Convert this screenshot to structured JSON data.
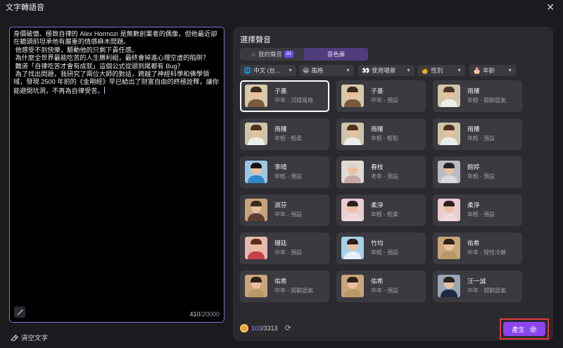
{
  "window": {
    "title": "文字轉語音"
  },
  "editor": {
    "text": "身價破億、極致自律的 Alex Hormozi 是無數創業者的偶像，但他最近卻在鏡頭前坦承他有嚴重的情感麻木問題。\n 他感受不到快樂，驅動他的只剩下責任感。\n 為什麼全世界最能吃苦的人生勝利組，最終會掉進心理空虛的陷阱？\n 難道「自律吃苦才會有成就」這個公式從頭到尾都有 Bug？\n 為了找出問題，我研究了兩位大師的對話，跨越了神經科學和佛學領域，發現 2500 年前的《金剛經》早已給出了財富自由的終極詮釋，讓你能避開坑洞，不再為自律受苦。",
    "count_current": "410",
    "count_max": "/20000"
  },
  "clear_label": "清空文字",
  "panel": {
    "title": "選擇聲音",
    "tabs": [
      {
        "label": "我的聲音",
        "badge": "AI"
      },
      {
        "label": "音色庫"
      }
    ],
    "filters": [
      {
        "icon": "globe",
        "label": "中文 (台..."
      },
      {
        "icon": "😀",
        "label": "風格"
      },
      {
        "icon": "👀",
        "label": "使用場景"
      },
      {
        "icon": "🧑",
        "label": "性別"
      },
      {
        "icon": "🎂",
        "label": "年齡"
      }
    ],
    "voices": [
      {
        "name": "子墨",
        "desc": "中年 - 沉穩風格",
        "selected": true,
        "hair": "#3a2a20",
        "body": "#7a5a3a",
        "bg": "#d9c7a8"
      },
      {
        "name": "子墨",
        "desc": "中年 - 預設",
        "hair": "#3a2a20",
        "body": "#7a5a3a",
        "bg": "#d9c7a8"
      },
      {
        "name": "雨樓",
        "desc": "年輕 - 閒聊語氣",
        "hair": "#4a3324",
        "body": "#e9efe8",
        "bg": "#cfc4a8"
      },
      {
        "name": "雨樓",
        "desc": "年輕 - 輕柔",
        "hair": "#4a3324",
        "body": "#e9efe8",
        "bg": "#cfc4a8"
      },
      {
        "name": "雨樓",
        "desc": "年輕 - 輕鬆",
        "hair": "#4a3324",
        "body": "#e9efe8",
        "bg": "#cfc4a8"
      },
      {
        "name": "雨樓",
        "desc": "年輕 - 預設",
        "hair": "#4a3324",
        "body": "#e9efe8",
        "bg": "#cfc4a8"
      },
      {
        "name": "李晴",
        "desc": "年輕 - 預設",
        "hair": "#1b1512",
        "body": "#2f86c8",
        "bg": "#9ec6e0"
      },
      {
        "name": "春枝",
        "desc": "老年 - 預設",
        "hair": "#d9d3cc",
        "body": "#c9a9a3",
        "bg": "#e2d9d2"
      },
      {
        "name": "婉婷",
        "desc": "年輕 - 預設",
        "hair": "#2a221e",
        "body": "#d8d8dc",
        "bg": "#b7bcc4"
      },
      {
        "name": "淑芬",
        "desc": "中年 - 預設",
        "hair": "#3b2a1e",
        "body": "#5a4030",
        "bg": "#c9a27a"
      },
      {
        "name": "柔淨",
        "desc": "年輕 - 輕柔",
        "hair": "#2b201b",
        "body": "#efd9dc",
        "bg": "#e9cdd2"
      },
      {
        "name": "柔淨",
        "desc": "年輕 - 預設",
        "hair": "#2b201b",
        "body": "#efd9dc",
        "bg": "#e9cdd2"
      },
      {
        "name": "珊廷",
        "desc": "中年 - 預設",
        "hair": "#5a2e20",
        "body": "#c8404a",
        "bg": "#e7b8b0"
      },
      {
        "name": "竹均",
        "desc": "年輕 - 預設",
        "hair": "#2a1d16",
        "body": "#e7eef5",
        "bg": "#a6d0e8"
      },
      {
        "name": "佑希",
        "desc": "中年 - 理性冷靜",
        "hair": "#2d211a",
        "body": "#b99766",
        "bg": "#c9a57a"
      },
      {
        "name": "佑希",
        "desc": "中年 - 閒聊語氣",
        "hair": "#2d211a",
        "body": "#b99766",
        "bg": "#c9a57a"
      },
      {
        "name": "佑希",
        "desc": "中年 - 預設",
        "hair": "#2d211a",
        "body": "#b99766",
        "bg": "#c9a57a"
      },
      {
        "name": "汪一誠",
        "desc": "中年 - 閒聊語氣",
        "hair": "#2a2220",
        "body": "#1f2a44",
        "bg": "#9aa6b4"
      },
      {
        "name": "",
        "desc": "",
        "hair": "#3a3a40",
        "body": "#3a3a40",
        "bg": "#3a3a40"
      },
      {
        "name": "",
        "desc": "",
        "hair": "#3a3a40",
        "body": "#3a3a40",
        "bg": "#3a3a40"
      },
      {
        "name": "",
        "desc": "",
        "hair": "#3a3a40",
        "body": "#3a3a40",
        "bg": "#3a3a40"
      }
    ]
  },
  "credits": {
    "used": "103",
    "total": "/3313"
  },
  "generate_label": "產生",
  "colors": {
    "accent": "#8b45ee",
    "highlight": "#e23a3a",
    "selection_outline": "#8f6bd9"
  }
}
